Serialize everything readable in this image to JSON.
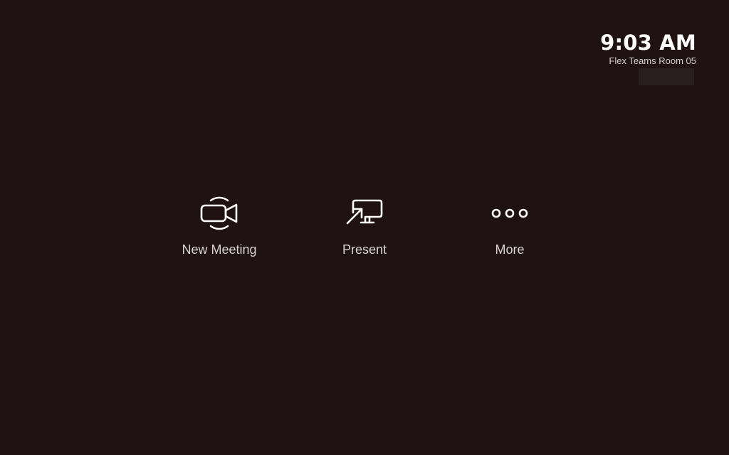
{
  "status": {
    "time": "9:03 AM",
    "room_name": "Flex Teams Room 05"
  },
  "actions": [
    {
      "label": "New Meeting",
      "icon": "video-camera-icon"
    },
    {
      "label": "Present",
      "icon": "screen-share-icon"
    },
    {
      "label": "More",
      "icon": "more-dots-icon"
    }
  ],
  "colors": {
    "background": "#201213",
    "text": "#ffffff",
    "label": "#d9d3d3"
  }
}
